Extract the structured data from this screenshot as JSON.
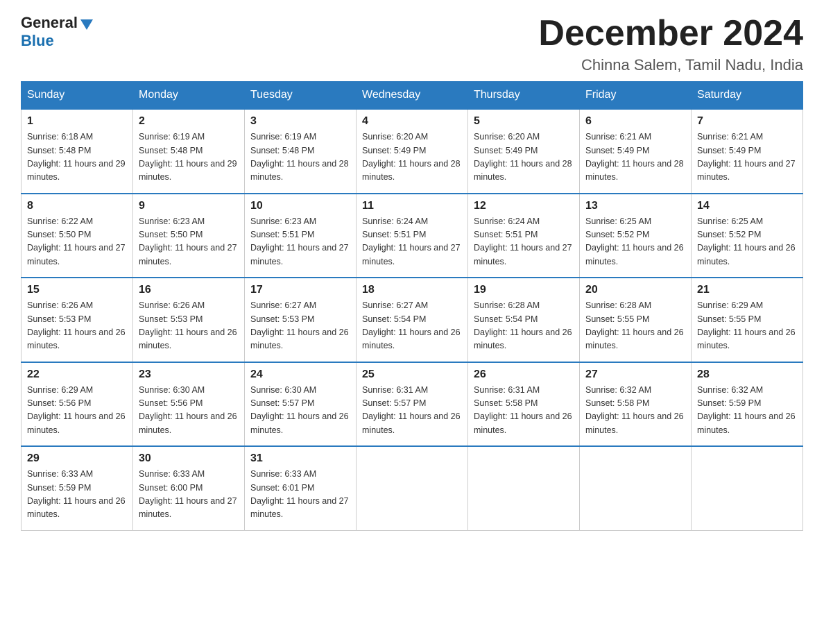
{
  "logo": {
    "general": "General",
    "blue": "Blue"
  },
  "header": {
    "month_year": "December 2024",
    "location": "Chinna Salem, Tamil Nadu, India"
  },
  "weekdays": [
    "Sunday",
    "Monday",
    "Tuesday",
    "Wednesday",
    "Thursday",
    "Friday",
    "Saturday"
  ],
  "weeks": [
    [
      {
        "day": "1",
        "sunrise": "6:18 AM",
        "sunset": "5:48 PM",
        "daylight": "11 hours and 29 minutes."
      },
      {
        "day": "2",
        "sunrise": "6:19 AM",
        "sunset": "5:48 PM",
        "daylight": "11 hours and 29 minutes."
      },
      {
        "day": "3",
        "sunrise": "6:19 AM",
        "sunset": "5:48 PM",
        "daylight": "11 hours and 28 minutes."
      },
      {
        "day": "4",
        "sunrise": "6:20 AM",
        "sunset": "5:49 PM",
        "daylight": "11 hours and 28 minutes."
      },
      {
        "day": "5",
        "sunrise": "6:20 AM",
        "sunset": "5:49 PM",
        "daylight": "11 hours and 28 minutes."
      },
      {
        "day": "6",
        "sunrise": "6:21 AM",
        "sunset": "5:49 PM",
        "daylight": "11 hours and 28 minutes."
      },
      {
        "day": "7",
        "sunrise": "6:21 AM",
        "sunset": "5:49 PM",
        "daylight": "11 hours and 27 minutes."
      }
    ],
    [
      {
        "day": "8",
        "sunrise": "6:22 AM",
        "sunset": "5:50 PM",
        "daylight": "11 hours and 27 minutes."
      },
      {
        "day": "9",
        "sunrise": "6:23 AM",
        "sunset": "5:50 PM",
        "daylight": "11 hours and 27 minutes."
      },
      {
        "day": "10",
        "sunrise": "6:23 AM",
        "sunset": "5:51 PM",
        "daylight": "11 hours and 27 minutes."
      },
      {
        "day": "11",
        "sunrise": "6:24 AM",
        "sunset": "5:51 PM",
        "daylight": "11 hours and 27 minutes."
      },
      {
        "day": "12",
        "sunrise": "6:24 AM",
        "sunset": "5:51 PM",
        "daylight": "11 hours and 27 minutes."
      },
      {
        "day": "13",
        "sunrise": "6:25 AM",
        "sunset": "5:52 PM",
        "daylight": "11 hours and 26 minutes."
      },
      {
        "day": "14",
        "sunrise": "6:25 AM",
        "sunset": "5:52 PM",
        "daylight": "11 hours and 26 minutes."
      }
    ],
    [
      {
        "day": "15",
        "sunrise": "6:26 AM",
        "sunset": "5:53 PM",
        "daylight": "11 hours and 26 minutes."
      },
      {
        "day": "16",
        "sunrise": "6:26 AM",
        "sunset": "5:53 PM",
        "daylight": "11 hours and 26 minutes."
      },
      {
        "day": "17",
        "sunrise": "6:27 AM",
        "sunset": "5:53 PM",
        "daylight": "11 hours and 26 minutes."
      },
      {
        "day": "18",
        "sunrise": "6:27 AM",
        "sunset": "5:54 PM",
        "daylight": "11 hours and 26 minutes."
      },
      {
        "day": "19",
        "sunrise": "6:28 AM",
        "sunset": "5:54 PM",
        "daylight": "11 hours and 26 minutes."
      },
      {
        "day": "20",
        "sunrise": "6:28 AM",
        "sunset": "5:55 PM",
        "daylight": "11 hours and 26 minutes."
      },
      {
        "day": "21",
        "sunrise": "6:29 AM",
        "sunset": "5:55 PM",
        "daylight": "11 hours and 26 minutes."
      }
    ],
    [
      {
        "day": "22",
        "sunrise": "6:29 AM",
        "sunset": "5:56 PM",
        "daylight": "11 hours and 26 minutes."
      },
      {
        "day": "23",
        "sunrise": "6:30 AM",
        "sunset": "5:56 PM",
        "daylight": "11 hours and 26 minutes."
      },
      {
        "day": "24",
        "sunrise": "6:30 AM",
        "sunset": "5:57 PM",
        "daylight": "11 hours and 26 minutes."
      },
      {
        "day": "25",
        "sunrise": "6:31 AM",
        "sunset": "5:57 PM",
        "daylight": "11 hours and 26 minutes."
      },
      {
        "day": "26",
        "sunrise": "6:31 AM",
        "sunset": "5:58 PM",
        "daylight": "11 hours and 26 minutes."
      },
      {
        "day": "27",
        "sunrise": "6:32 AM",
        "sunset": "5:58 PM",
        "daylight": "11 hours and 26 minutes."
      },
      {
        "day": "28",
        "sunrise": "6:32 AM",
        "sunset": "5:59 PM",
        "daylight": "11 hours and 26 minutes."
      }
    ],
    [
      {
        "day": "29",
        "sunrise": "6:33 AM",
        "sunset": "5:59 PM",
        "daylight": "11 hours and 26 minutes."
      },
      {
        "day": "30",
        "sunrise": "6:33 AM",
        "sunset": "6:00 PM",
        "daylight": "11 hours and 27 minutes."
      },
      {
        "day": "31",
        "sunrise": "6:33 AM",
        "sunset": "6:01 PM",
        "daylight": "11 hours and 27 minutes."
      },
      null,
      null,
      null,
      null
    ]
  ]
}
